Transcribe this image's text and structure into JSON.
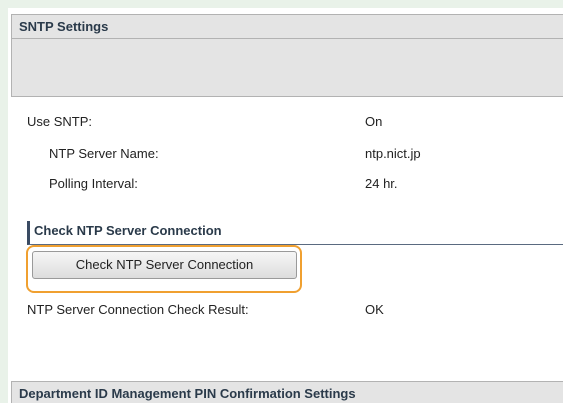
{
  "sntp": {
    "header": "SNTP Settings",
    "use_sntp_label": "Use SNTP:",
    "use_sntp_value": "On",
    "server_name_label": "NTP Server Name:",
    "server_name_value": "ntp.nict.jp",
    "polling_label": "Polling Interval:",
    "polling_value": "24 hr."
  },
  "check": {
    "section_title": "Check NTP Server Connection",
    "button_label": "Check NTP Server Connection",
    "result_label": "NTP Server Connection Check Result:",
    "result_value": "OK"
  },
  "dept": {
    "header": "Department ID Management PIN Confirmation Settings"
  }
}
